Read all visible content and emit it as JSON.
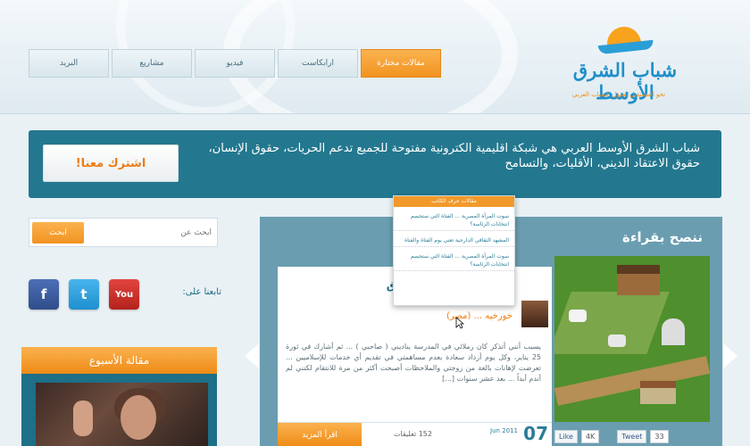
{
  "header": {
    "logo_text": "شباب الشرق الأوسط",
    "logo_tagline": "نحو المستقبل بعقول الشباب العربي",
    "nav_tabs": [
      {
        "label": "البريد"
      },
      {
        "label": "مشاريع"
      },
      {
        "label": "فيديو"
      },
      {
        "label": "ارابكاست"
      },
      {
        "label": "مقالات مختارة"
      }
    ]
  },
  "intro": {
    "text": "شباب الشرق الأوسط العربي هي شبكة اقليمية الكترونية مفتوحة للجميع تدعم الحريات، حقوق الإنسان، حقوق الاعتقاد الديني، الأقليات، والتسامح",
    "subscribe_label": "اشترك معنا!"
  },
  "search": {
    "placeholder": "ابحث عن",
    "button_label": "ابحث"
  },
  "social": {
    "follow_label": "تابعنا على:",
    "facebook": "f",
    "twitter": "t",
    "youtube": "You"
  },
  "week_article": {
    "title": "مقالة الأسبوع"
  },
  "featured": {
    "section_title": "ننصح بقراءة",
    "article_title": "العراقي ... : ممدوح رزق",
    "author": "خورخيه ... (مصر)",
    "body": "يسبب أنني أتذكر كان رملائي في المدرسة يناديني ( صاحبي ) ... ثم أشارك في ثورة 25 يناير، وكل يوم أزداد سعادة بعدم مساهمتي في تقديم أي خدمات للإسلاميين ... تعرضت لإهانات بالغة من زوجتي والملاحظات أصبحت أكثر من مرة للانتقام لكنني لم أندم أبداً ... بعد عشر سنوات [...]",
    "read_more": "اقرأ المزيد",
    "comments": "152 تعليقات",
    "date_day": "07",
    "date_month": "Jun 2011",
    "like_label": "Like",
    "like_count": "4K",
    "tweet_label": "Tweet",
    "tweet_count": "33"
  },
  "popup": {
    "header": "مقالات حرف الكاتب",
    "items": [
      "سوت المرأة المصرية ... الفتاة التي ستحسم انتخابات الرئاسة؟",
      "المشهد الثقافي الدارجية تعني يوم الفتاة والفتاة",
      "سوت المرأة المصرية ... الفتاة التي ستحسم انتخابات الرئاسة؟"
    ]
  }
}
